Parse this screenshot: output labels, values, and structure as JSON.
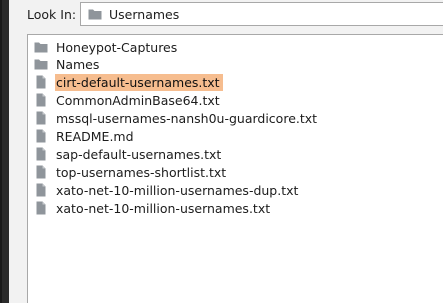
{
  "look_in": {
    "label": "Look In:",
    "current_folder": "Usernames"
  },
  "files": [
    {
      "name": "Honeypot-Captures",
      "type": "folder",
      "selected": false
    },
    {
      "name": "Names",
      "type": "folder",
      "selected": false
    },
    {
      "name": "cirt-default-usernames.txt",
      "type": "file",
      "selected": true
    },
    {
      "name": "CommonAdminBase64.txt",
      "type": "file",
      "selected": false
    },
    {
      "name": "mssql-usernames-nansh0u-guardicore.txt",
      "type": "file",
      "selected": false
    },
    {
      "name": "README.md",
      "type": "file",
      "selected": false
    },
    {
      "name": "sap-default-usernames.txt",
      "type": "file",
      "selected": false
    },
    {
      "name": "top-usernames-shortlist.txt",
      "type": "file",
      "selected": false
    },
    {
      "name": "xato-net-10-million-usernames-dup.txt",
      "type": "file",
      "selected": false
    },
    {
      "name": "xato-net-10-million-usernames.txt",
      "type": "file",
      "selected": false
    }
  ],
  "colors": {
    "selection": "#f6bd8f",
    "folder_icon": "#8f959b",
    "file_icon": "#8f959b"
  },
  "icons": {
    "folder": "folder-icon",
    "file": "file-icon"
  }
}
